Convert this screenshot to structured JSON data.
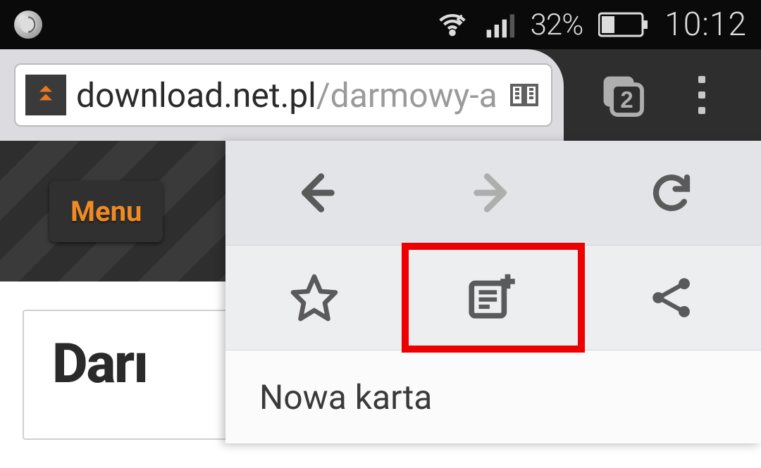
{
  "status": {
    "battery_percent": "32%",
    "clock": "10:12"
  },
  "browser": {
    "url_host": "download.net.pl",
    "url_path": "/darmowy-a",
    "tab_count": "2"
  },
  "page": {
    "menu_label": "Menu",
    "heading_visible": "Darı"
  },
  "dropdown": {
    "items": {
      "new_tab": "Nowa karta"
    }
  }
}
